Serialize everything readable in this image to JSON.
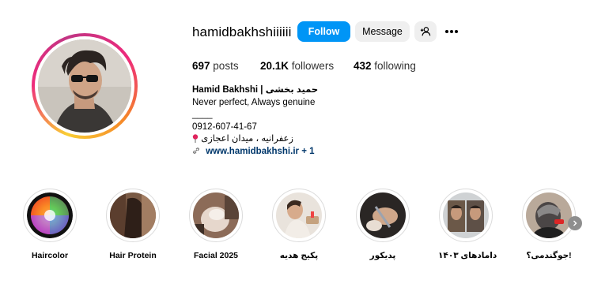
{
  "profile": {
    "username": "hamidbakhshiiiiii",
    "follow_label": "Follow",
    "message_label": "Message",
    "posts_count": "697",
    "posts_label": "posts",
    "followers_count": "20.1K",
    "followers_label": "followers",
    "following_count": "432",
    "following_label": "following"
  },
  "bio": {
    "name": "Hamid Bakhshi | حمید بخشی",
    "tagline": "Never perfect, Always genuine",
    "divider": "____",
    "phone": "0912-607-41-67",
    "location": "زعفرانیه ، میدان اعجازی",
    "link": "www.hamidbakhshi.ir",
    "link_more": "+ 1"
  },
  "highlights": [
    {
      "label": "Haircolor"
    },
    {
      "label": "Hair Protein"
    },
    {
      "label": "Facial 2025"
    },
    {
      "label": "پکیج هدیه"
    },
    {
      "label": "پدیکور"
    },
    {
      "label": "دامادهای ۱۴۰۳"
    },
    {
      "label": "جوگندمی؟!"
    }
  ],
  "icons": {
    "add_user": "add-user-icon",
    "more": "more-options-icon",
    "link": "link-icon",
    "pin": "pin-icon",
    "next": "chevron-right-icon"
  },
  "colors": {
    "follow_bg": "#0095f6",
    "link": "#00376b",
    "secondary_bg": "#efefef"
  }
}
